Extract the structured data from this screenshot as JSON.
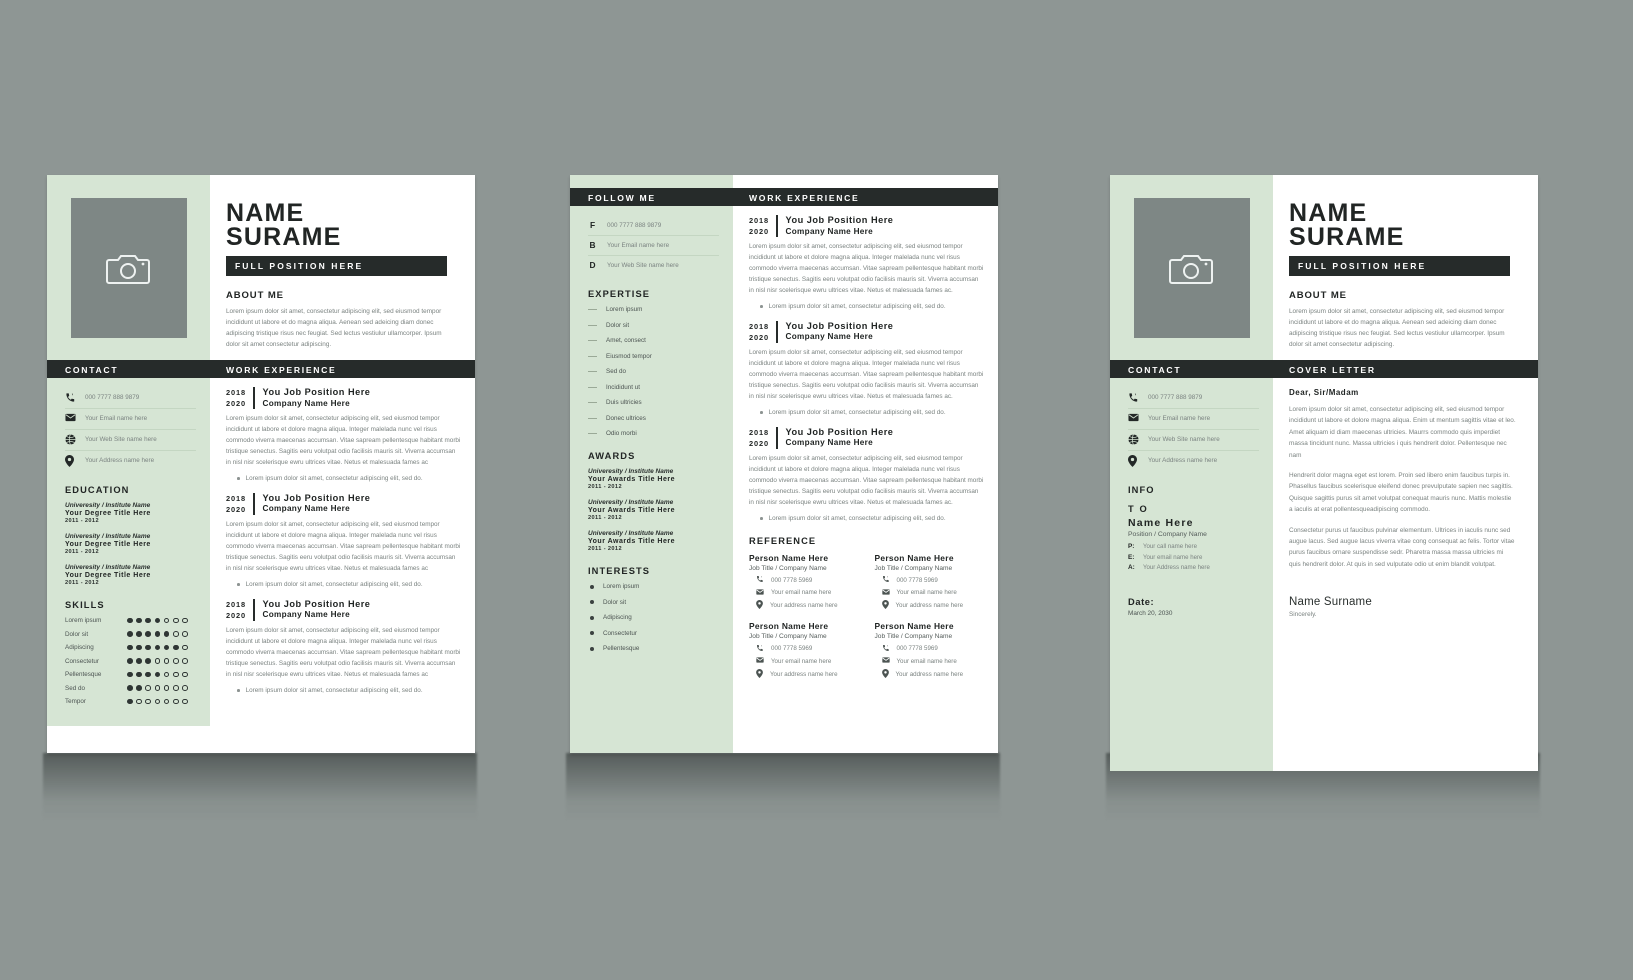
{
  "theme": {
    "background": "#8e9694",
    "page_bg": "#ffffff",
    "sidebar_green": "#d6e5d4",
    "bar_dark": "#262b2a",
    "photo_gray": "#7e8785",
    "body_text": "#7b8381"
  },
  "page1": {
    "name_line1": "NAME",
    "name_line2": "SURAME",
    "position_bar": "FULL POSITION HERE",
    "about_heading": "ABOUT ME",
    "about_text": "Lorem ipsum dolor sit amet, consectetur adipiscing elit, sed eiusmod tempor incididunt ut labore et do magna aliqua. Aenean sed adeicing diam donec adipiscing tristique risus nec feugiat. Sed lectus vestiulur ullamcorper. Ipsum dolor sit amet consectetur adipiscing.",
    "bar_left": "CONTACT",
    "bar_right": "WORK EXPERIENCE",
    "contact": [
      {
        "icon": "phone-icon",
        "text": "000 7777 888 9879"
      },
      {
        "icon": "envelope-icon",
        "text": "Your Email name here"
      },
      {
        "icon": "globe-icon",
        "text": "Your Web Site name here"
      },
      {
        "icon": "location-pin-icon",
        "text": "Your Address name here"
      }
    ],
    "education_heading": "EDUCATION",
    "education": [
      {
        "university": "Univeresity / Institute Name",
        "degree": "Your Degree Title Here",
        "years": "2011 - 2012"
      },
      {
        "university": "Univeresity / Institute Name",
        "degree": "Your Degree Title Here",
        "years": "2011 - 2012"
      },
      {
        "university": "Univeresity / Institute Name",
        "degree": "Your Degree Title Here",
        "years": "2011 - 2012"
      }
    ],
    "skills_heading": "SKILLS",
    "skills": [
      {
        "name": "Lorem ipsum",
        "filled": 4,
        "total": 7
      },
      {
        "name": "Dolor sit",
        "filled": 5,
        "total": 7
      },
      {
        "name": "Adipiscing",
        "filled": 6,
        "total": 7
      },
      {
        "name": "Consectetur",
        "filled": 3,
        "total": 7
      },
      {
        "name": "Pellentesque",
        "filled": 4,
        "total": 7
      },
      {
        "name": "Sed do",
        "filled": 2,
        "total": 7
      },
      {
        "name": "Tempor",
        "filled": 1,
        "total": 7
      }
    ],
    "jobs": [
      {
        "year_from": "2018",
        "year_to": "2020",
        "title": "You Job Position Here",
        "company": "Company Name Here",
        "paragraph": "Lorem ipsum dolor sit amet, consectetur adipiscing elit, sed eiusmod tempor incididunt ut labore et dolore magna aliqua. Integer malelada nunc vel risus commodo viverra maecenas accumsan. Vitae sapream pellentesque habitant morbi tristique senectus. Sagitis eeru volutpat odio facilisis mauris sit. Viverra accumsan in nisl nisr scelerisque ewru ultrices vitae. Netus et malesuada fames ac",
        "bullet": "Lorem ipsum dolor sit amet, consectetur adipiscing elit, sed do."
      },
      {
        "year_from": "2018",
        "year_to": "2020",
        "title": "You Job Position Here",
        "company": "Company Name Here",
        "paragraph": "Lorem ipsum dolor sit amet, consectetur adipiscing elit, sed eiusmod tempor incididunt ut labore et dolore magna aliqua. Integer malelada nunc vel risus commodo viverra maecenas accumsan. Vitae sapream pellentesque habitant morbi tristique senectus. Sagitis eeru volutpat odio facilisis mauris sit. Viverra accumsan in nisl nisr scelerisque ewru ultrices vitae. Netus et malesuada fames ac",
        "bullet": "Lorem ipsum dolor sit amet, consectetur adipiscing elit, sed do."
      },
      {
        "year_from": "2018",
        "year_to": "2020",
        "title": "You Job Position Here",
        "company": "Company Name Here",
        "paragraph": "Lorem ipsum dolor sit amet, consectetur adipiscing elit, sed eiusmod tempor incididunt ut labore et dolore magna aliqua. Integer malelada nunc vel risus commodo viverra maecenas accumsan. Vitae sapream pellentesque habitant morbi tristique senectus. Sagitis eeru volutpat odio facilisis mauris sit. Viverra accumsan in nisl nisr scelerisque ewru ultrices vitae. Netus et malesuada fames ac",
        "bullet": "Lorem ipsum dolor sit amet, consectetur adipiscing elit, sed do."
      }
    ]
  },
  "page2": {
    "bar_left": "FOLLOW ME",
    "bar_right": "WORK EXPERIENCE",
    "follow": [
      {
        "letter": "F",
        "text": "000 7777 888 9879"
      },
      {
        "letter": "B",
        "text": "Your Email name here"
      },
      {
        "letter": "D",
        "text": "Your Web Site name here"
      }
    ],
    "expertise_heading": "EXPERTISE",
    "expertise": [
      "Lorem ipsum",
      "Dolor sit",
      "Amet, consect",
      "Eiusmod tempor",
      "Sed do",
      "Incididunt ut",
      "Duis ultricies",
      "Donec ultrices",
      "Odio morbi"
    ],
    "awards_heading": "AWARDS",
    "awards": [
      {
        "university": "Univeresity / Institute Name",
        "title": "Your Awards Title Here",
        "years": "2011 - 2012"
      },
      {
        "university": "Univeresity / Institute Name",
        "title": "Your Awards Title Here",
        "years": "2011 - 2012"
      },
      {
        "university": "Univeresity / Institute Name",
        "title": "Your Awards Title Here",
        "years": "2011 - 2012"
      }
    ],
    "interests_heading": "INTERESTS",
    "interests": [
      "Lorem ipsum",
      "Dolor sit",
      "Adipiscing",
      "Consectetur",
      "Pellentesque"
    ],
    "jobs": [
      {
        "year_from": "2018",
        "year_to": "2020",
        "title": "You Job Position Here",
        "company": "Company Name Here",
        "paragraph": "Lorem ipsum dolor sit amet, consectetur adipiscing elit, sed eiusmod tempor incididunt ut labore et dolore magna aliqua. Integer malelada nunc vel risus commodo viverra maecenas accumsan. Vitae sapream pellentesque habitant morbi tristique senectus. Sagitis eeru volutpat odio facilisis mauris sit. Viverra accumsan in nisl nisr scelerisque ewru ultrices vitae. Netus et malesuada fames ac.",
        "bullet": "Lorem ipsum dolor sit amet, consectetur adipiscing elit, sed do."
      },
      {
        "year_from": "2018",
        "year_to": "2020",
        "title": "You Job Position Here",
        "company": "Company Name Here",
        "paragraph": "Lorem ipsum dolor sit amet, consectetur adipiscing elit, sed eiusmod tempor incididunt ut labore et dolore magna aliqua. Integer malelada nunc vel risus commodo viverra maecenas accumsan. Vitae sapream pellentesque habitant morbi tristique senectus. Sagitis eeru volutpat odio facilisis mauris sit. Viverra accumsan in nisl nisr scelerisque ewru ultrices vitae. Netus et malesuada fames ac.",
        "bullet": "Lorem ipsum dolor sit amet, consectetur adipiscing elit, sed do."
      },
      {
        "year_from": "2018",
        "year_to": "2020",
        "title": "You Job Position Here",
        "company": "Company Name Here",
        "paragraph": "Lorem ipsum dolor sit amet, consectetur adipiscing elit, sed eiusmod tempor incididunt ut labore et dolore magna aliqua. Integer malelada nunc vel risus commodo viverra maecenas accumsan. Vitae sapream pellentesque habitant morbi tristique senectus. Sagitis eeru volutpat odio facilisis mauris sit. Viverra accumsan in nisl nisr scelerisque ewru ultrices vitae. Netus et malesuada fames ac.",
        "bullet": "Lorem ipsum dolor sit amet, consectetur adipiscing elit, sed do."
      }
    ],
    "reference_heading": "REFERENCE",
    "references": [
      {
        "name": "Person Name Here",
        "job": "Job Title / Company Name",
        "phone": "000 7778 5969",
        "email": "Your email name here",
        "address": "Your address name here"
      },
      {
        "name": "Person Name Here",
        "job": "Job Title / Company Name",
        "phone": "000 7778 5969",
        "email": "Your email name here",
        "address": "Your address name here"
      },
      {
        "name": "Person Name Here",
        "job": "Job Title / Company Name",
        "phone": "000 7778 5969",
        "email": "Your email name here",
        "address": "Your address name here"
      },
      {
        "name": "Person Name Here",
        "job": "Job Title / Company Name",
        "phone": "000 7778 5969",
        "email": "Your email name here",
        "address": "Your address name here"
      }
    ]
  },
  "page3": {
    "name_line1": "NAME",
    "name_line2": "SURAME",
    "position_bar": "FULL POSITION HERE",
    "about_heading": "ABOUT ME",
    "about_text": "Lorem ipsum dolor sit amet, consectetur adipiscing elit, sed eiusmod tempor incididunt ut labore et do magna aliqua. Aenean sed adeicing diam donec adipiscing tristique risus nec feugiat. Sed lectus vestiulur ullamcorper. Ipsum dolor sit amet consectetur adipiscing.",
    "bar_left": "CONTACT",
    "bar_right": "COVER LETTER",
    "contact": [
      {
        "icon": "phone-icon",
        "text": "000 7777 888 9879"
      },
      {
        "icon": "envelope-icon",
        "text": "Your Email name here"
      },
      {
        "icon": "globe-icon",
        "text": "Your Web Site name here"
      },
      {
        "icon": "location-pin-icon",
        "text": "Your Address name here"
      }
    ],
    "info_heading": "INFO",
    "info_to": "T O",
    "info_name": "Name Here",
    "info_position": "Position / Company Name",
    "info_lines": [
      {
        "key": "P:",
        "value": "Your  call name here"
      },
      {
        "key": "E:",
        "value": "Your  email name here"
      },
      {
        "key": "A:",
        "value": "Your  Address name here"
      }
    ],
    "date_heading": "Date:",
    "date_value": "March 20, 2030",
    "salutation": "Dear, Sir/Madam",
    "paragraphs": [
      "Lorem ipsum dolor sit amet, consectetur adipiscing elit, sed eiusmod tempor incididunt ut labore et dolore magna aliqua. Enim ut mentum sagittis vitae et leo. Amet aliquam id diam maecenas ultricies. Maurrs commodo quis imperdiet massa tincidunt nunc. Massa ultricies i quis hendrerit dolor. Pellentesque nec nam",
      "Hendrerit dolor magna eget est lorem. Proin sed libero enim faucibus turpis in. Phasellus faucibus scelerisque eleifend donec prevulputate sapien nec sagittis. Quisque sagittis purus sit amet volutpat conequat mauris nunc. Mattis molestie a iaculis at erat pollentesqueadipiscing commodo.",
      "Consectetur purus ut faucibus pulvinar elementum. Ultrices in iaculis nunc sed augue lacus. Sed augue lacus viverra vitae cong consequat ac felis. Tortor vitae purus faucibus ornare suspendisse sedr. Pharetra massa massa ultricies mi quis hendrerit dolor. At quis in sed vulputate odio ut enim blandit volutpat."
    ],
    "signature_name": "Name Surname",
    "signature_sub": "Sincerely."
  }
}
